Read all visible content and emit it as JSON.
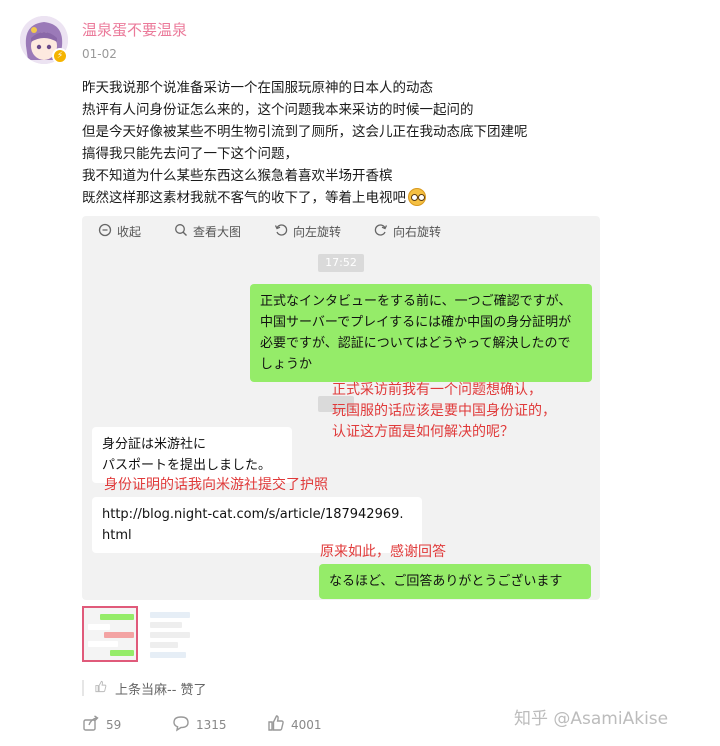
{
  "author": {
    "name": "温泉蛋不要温泉",
    "date": "01-02",
    "badge_icon": "lightning-badge-icon"
  },
  "post": {
    "lines": [
      "昨天我说那个说准备采访一个在国服玩原神的日本人的动态",
      "热评有人问身份证怎么来的，这个问题我本来采访的时候一起问的",
      "但是今天好像被某些不明生物引流到了厕所，这会儿正在我动态底下团建呢",
      "搞得我只能先去问了一下这个问题，",
      "我不知道为什么某些东西这么猴急着喜欢半场开香槟",
      "既然这样那这素材我就不客气的收下了，等着上电视吧"
    ]
  },
  "viewer_toolbar": {
    "collapse": "收起",
    "view_large": "查看大图",
    "rotate_left": "向左旋转",
    "rotate_right": "向右旋转"
  },
  "chat": {
    "timestamp": "17:52",
    "msg1": "正式なインタビューをする前に、一つご確認ですが、中国サーバーでプレイするには確か中国の身分証明が必要ですが、認証についてはどうやって解決したのでしょうか",
    "note1": [
      "正式采访前我有一个问题想确认，",
      "玩国服的话应该是要中国身份证的，",
      "认证这方面是如何解决的呢？"
    ],
    "msg2_lines": [
      "身分証は米游社に",
      "パスポートを提出しました。"
    ],
    "note2": "身份证明的话我向米游社提交了护照",
    "msg3_lines": [
      "http://blog.night-cat.com/s/article/187942969.",
      "html"
    ],
    "note3": "原来如此，感谢回答",
    "msg4": "なるほど、ご回答ありがとうございます"
  },
  "likes": {
    "text": "上条当麻-- 赞了"
  },
  "actions": {
    "repost_count": "59",
    "comment_count": "1315",
    "like_count": "4001"
  },
  "watermark": "知乎 @AsamiAkise",
  "colors": {
    "accent_pink": "#eb7a9a",
    "bubble_green": "#95ec69",
    "annotation_red": "#e03a3a"
  }
}
